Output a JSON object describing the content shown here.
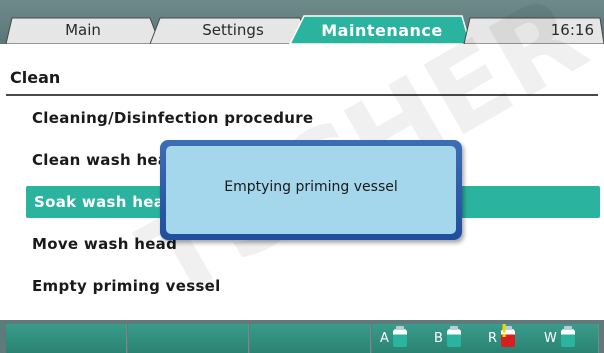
{
  "tabs": {
    "main_label": "Main",
    "settings_label": "Settings",
    "maintenance_label": "Maintenance",
    "active": "maintenance"
  },
  "clock": "16:16",
  "section": {
    "title": "Clean"
  },
  "menu": {
    "items": [
      {
        "label": "Cleaning/Disinfection procedure"
      },
      {
        "label": "Clean wash head"
      },
      {
        "label": "Soak wash head"
      },
      {
        "label": "Move wash head"
      },
      {
        "label": "Empty priming vessel"
      }
    ],
    "selected_index": 2
  },
  "dialog": {
    "message": "Emptying priming vessel"
  },
  "watermark": "TSCHER",
  "status": {
    "indicators": [
      {
        "letter": "A",
        "state": "ok",
        "icon": "bottle-icon"
      },
      {
        "letter": "B",
        "state": "ok",
        "icon": "bottle-icon"
      },
      {
        "letter": "R",
        "state": "warning",
        "icon": "bottle-warning-icon"
      },
      {
        "letter": "W",
        "state": "ok",
        "icon": "bottle-icon"
      }
    ]
  },
  "colors": {
    "accent": "#2ab39e",
    "active_tab": "#2ab39e",
    "dialog_border": "#2c5ea8",
    "dialog_bg": "#a4d6ec",
    "warning": "#d62020",
    "warning_mark": "#f2d400"
  }
}
